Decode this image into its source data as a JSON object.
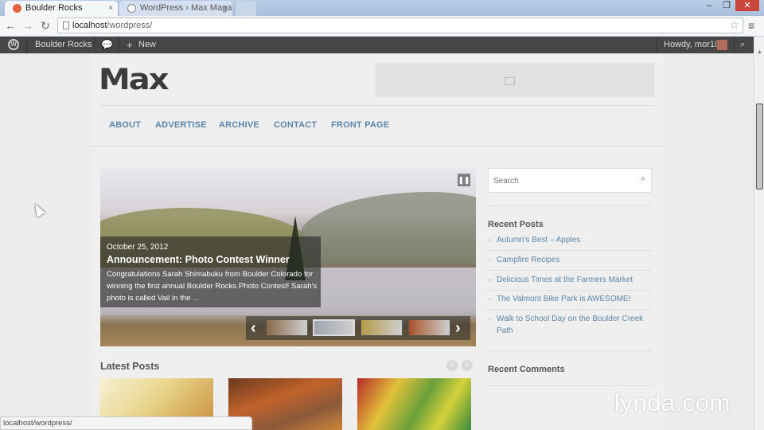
{
  "browser": {
    "tabs": [
      {
        "label": "Boulder Rocks",
        "active": true
      },
      {
        "label": "WordPress › Max Magazine",
        "active": false
      }
    ],
    "address": {
      "host": "localhost",
      "path": "/wordpress/"
    },
    "close_glyph": "×",
    "window_controls": [
      "–",
      "❐",
      "✕"
    ],
    "status_text": "localhost/wordpress/"
  },
  "admin_bar": {
    "site_name": "Boulder Rocks",
    "new_label": "New",
    "plus_glyph": "+",
    "howdy": "Howdy, mor10"
  },
  "site": {
    "logo": "Max",
    "nav": [
      "ABOUT",
      "ADVERTISE",
      "ARCHIVE",
      "CONTACT",
      "FRONT PAGE"
    ]
  },
  "slider": {
    "date": "October 25, 2012",
    "title": "Announcement: Photo Contest Winner",
    "excerpt": "Congratulations Sarah Shimabuku from Boulder Colorado for winning the first annual Boulder Rocks Photo Contest! Sarah's photo is called Vail in the ...",
    "thumb_colors": [
      "#8a6a4a",
      "#9fa5b0",
      "#b49a48",
      "#a8542a"
    ]
  },
  "latest": {
    "title": "Latest Posts",
    "prev_glyph": "‹",
    "next_glyph": "›"
  },
  "sidebar": {
    "search_placeholder": "Search",
    "recent_posts_title": "Recent Posts",
    "recent_posts": [
      "Autumn's Best – Apples",
      "Campfire Recipes",
      "Delicious Times at the Farmers Market",
      "The Valmont Bike Park is AWESOME!",
      "Walk to School Day on the Boulder Creek Path"
    ],
    "recent_comments_title": "Recent Comments"
  },
  "watermark": "lynda.com",
  "colors": {
    "link": "#5b86a8",
    "admin_bar": "#464646"
  }
}
